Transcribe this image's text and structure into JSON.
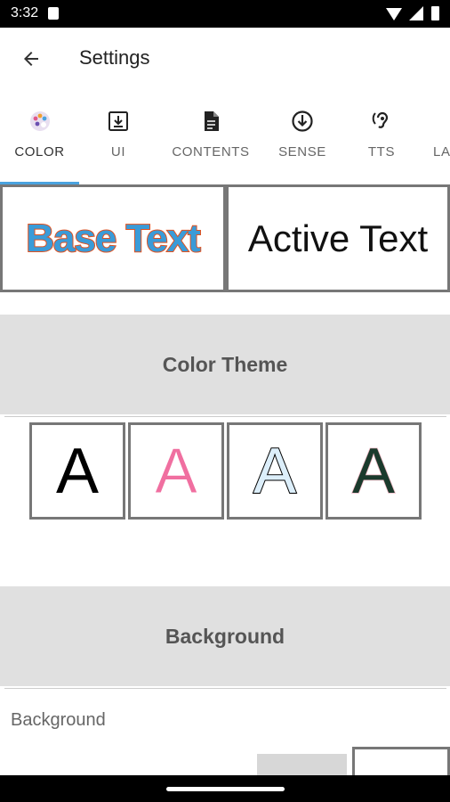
{
  "status_bar": {
    "time": "3:32"
  },
  "app_bar": {
    "title": "Settings"
  },
  "tabs": [
    {
      "label": "COLOR",
      "icon": "palette-icon",
      "active": true
    },
    {
      "label": "UI",
      "icon": "download-box-icon"
    },
    {
      "label": "CONTENTS",
      "icon": "document-icon"
    },
    {
      "label": "SENSE",
      "icon": "arrow-circle-down-icon"
    },
    {
      "label": "TTS",
      "icon": "hearing-icon"
    },
    {
      "label": "LA",
      "icon": ""
    }
  ],
  "preview": {
    "base_text": "Base Text",
    "active_text": "Active Text"
  },
  "color_theme": {
    "header": "Color Theme",
    "options": [
      {
        "letter": "A",
        "fill": "#000000",
        "stroke": ""
      },
      {
        "letter": "A",
        "fill": "#f06fa0",
        "stroke": "#ffffff"
      },
      {
        "letter": "A",
        "fill": "#dceefa",
        "stroke": "#000000"
      },
      {
        "letter": "A",
        "fill": "#1b3a2c",
        "stroke": "#f3b8c4"
      }
    ]
  },
  "background": {
    "header": "Background",
    "label": "Background"
  },
  "colors": {
    "accent": "#4aa3df",
    "base_text_fill": "#3a9bd8",
    "base_text_stroke": "#e2521f",
    "section_bg": "#e0e0e0"
  }
}
